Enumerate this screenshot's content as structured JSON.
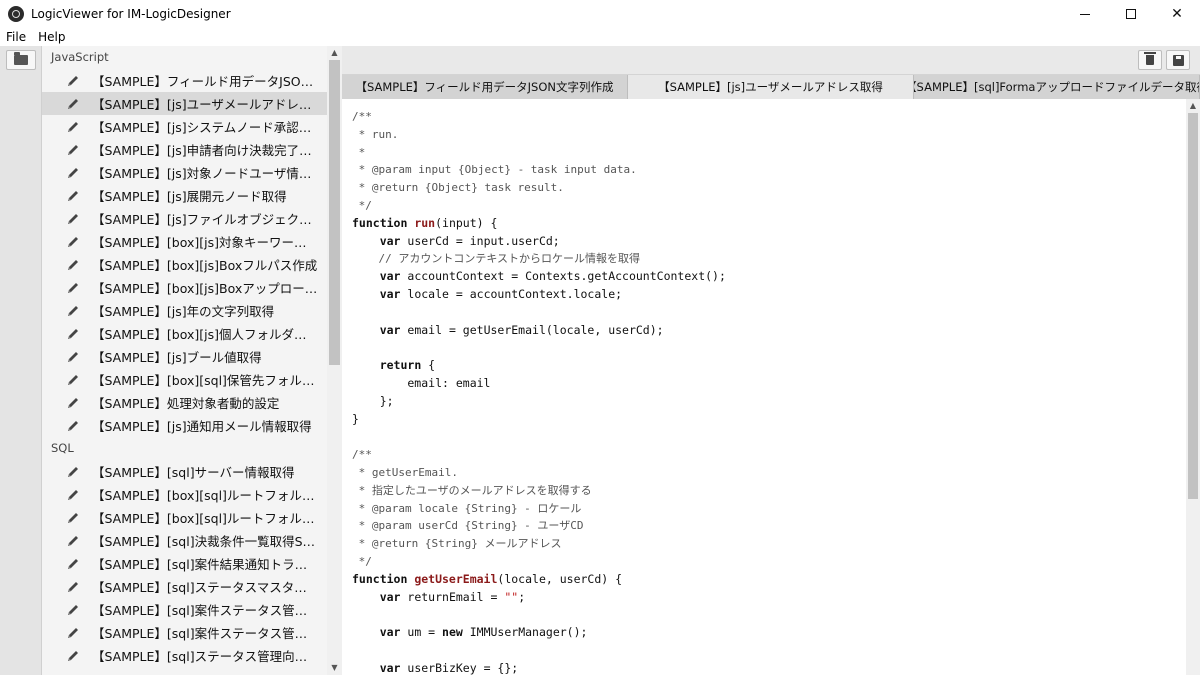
{
  "window": {
    "title": "LogicViewer for IM-LogicDesigner",
    "minimize_icon": "minimize-icon",
    "maximize_icon": "maximize-icon",
    "close_glyph": "✕"
  },
  "menu": {
    "file": "File",
    "help": "Help"
  },
  "toolbar": {
    "open_icon": "folder-icon",
    "delete_icon": "trash-icon",
    "save_icon": "save-icon"
  },
  "sidebar": {
    "groups": [
      {
        "label": "JavaScript",
        "items": [
          "【SAMPLE】フィールド用データJSON文字列作成",
          "【SAMPLE】[js]ユーザメールアドレス取得",
          "【SAMPLE】[js]システムノード承認処理",
          "【SAMPLE】[js]申請者向け決裁完了メール",
          "【SAMPLE】[js]対象ノードユーザ情報取得",
          "【SAMPLE】[js]展開元ノード取得",
          "【SAMPLE】[js]ファイルオブジェクト生成",
          "【SAMPLE】[box][js]対象キーワード検索",
          "【SAMPLE】[box][js]Boxフルパス作成",
          "【SAMPLE】[box][js]Boxアップロード処理",
          "【SAMPLE】[js]年の文字列取得",
          "【SAMPLE】[box][js]個人フォルダ抽出",
          "【SAMPLE】[js]ブール値取得",
          "【SAMPLE】[box][sql]保管先フォルダ取得",
          "【SAMPLE】処理対象者動的設定",
          "【SAMPLE】[js]通知用メール情報取得"
        ]
      },
      {
        "label": "SQL",
        "items": [
          "【SAMPLE】[sql]サーバー情報取得",
          "【SAMPLE】[box][sql]ルートフォルダ取得",
          "【SAMPLE】[box][sql]ルートフォルダ登録",
          "【SAMPLE】[sql]決裁条件一覧取得SQL",
          "【SAMPLE】[sql]案件結果通知トランザクション",
          "【SAMPLE】[sql]ステータスマスタデータ取得",
          "【SAMPLE】[sql]案件ステータス管理登録",
          "【SAMPLE】[sql]案件ステータス管理更新",
          "【SAMPLE】[sql]ステータス管理向け取得"
        ]
      }
    ],
    "selected": {
      "group": 0,
      "item": 1
    }
  },
  "tabs": [
    {
      "label": "【SAMPLE】フィールド用データJSON文字列作成",
      "active": false
    },
    {
      "label": "【SAMPLE】[js]ユーザメールアドレス取得",
      "active": true
    },
    {
      "label": "【SAMPLE】[sql]Formaアップロードファイルデータ取得",
      "active": false
    }
  ],
  "code": [
    {
      "kind": "comment",
      "text": "/**"
    },
    {
      "kind": "comment",
      "text": " * run."
    },
    {
      "kind": "comment",
      "text": " *"
    },
    {
      "kind": "comment",
      "text": " * @param input {Object} - task input data."
    },
    {
      "kind": "comment",
      "text": " * @return {Object} task result."
    },
    {
      "kind": "comment",
      "text": " */"
    },
    {
      "kind": "code",
      "tokens": [
        [
          "kw",
          "function "
        ],
        [
          "fn",
          "run"
        ],
        [
          "",
          "(input) {"
        ]
      ]
    },
    {
      "kind": "code",
      "tokens": [
        [
          "",
          "    "
        ],
        [
          "kw",
          "var "
        ],
        [
          "",
          "userCd = input.userCd;"
        ]
      ]
    },
    {
      "kind": "comment",
      "text": "    // アカウントコンテキストからロケール情報を取得"
    },
    {
      "kind": "code",
      "tokens": [
        [
          "",
          "    "
        ],
        [
          "kw",
          "var "
        ],
        [
          "",
          "accountContext = Contexts.getAccountContext();"
        ]
      ]
    },
    {
      "kind": "code",
      "tokens": [
        [
          "",
          "    "
        ],
        [
          "kw",
          "var "
        ],
        [
          "",
          "locale = accountContext.locale;"
        ]
      ]
    },
    {
      "kind": "code",
      "tokens": [
        [
          "",
          ""
        ]
      ]
    },
    {
      "kind": "code",
      "tokens": [
        [
          "",
          "    "
        ],
        [
          "kw",
          "var "
        ],
        [
          "",
          "email = getUserEmail(locale, userCd);"
        ]
      ]
    },
    {
      "kind": "code",
      "tokens": [
        [
          "",
          ""
        ]
      ]
    },
    {
      "kind": "code",
      "tokens": [
        [
          "",
          "    "
        ],
        [
          "kw",
          "return "
        ],
        [
          "",
          "{"
        ]
      ]
    },
    {
      "kind": "code",
      "tokens": [
        [
          "",
          "        email: email"
        ]
      ]
    },
    {
      "kind": "code",
      "tokens": [
        [
          "",
          "    };"
        ]
      ]
    },
    {
      "kind": "code",
      "tokens": [
        [
          "",
          "}"
        ]
      ]
    },
    {
      "kind": "code",
      "tokens": [
        [
          "",
          ""
        ]
      ]
    },
    {
      "kind": "comment",
      "text": "/**"
    },
    {
      "kind": "comment",
      "text": " * getUserEmail."
    },
    {
      "kind": "comment",
      "text": " * 指定したユーザのメールアドレスを取得する"
    },
    {
      "kind": "comment",
      "text": " * @param locale {String} - ロケール"
    },
    {
      "kind": "comment",
      "text": " * @param userCd {String} - ユーザCD"
    },
    {
      "kind": "comment",
      "text": " * @return {String} メールアドレス"
    },
    {
      "kind": "comment",
      "text": " */"
    },
    {
      "kind": "code",
      "tokens": [
        [
          "kw",
          "function "
        ],
        [
          "fn",
          "getUserEmail"
        ],
        [
          "",
          "(locale, userCd) {"
        ]
      ]
    },
    {
      "kind": "code",
      "tokens": [
        [
          "",
          "    "
        ],
        [
          "kw",
          "var "
        ],
        [
          "",
          "returnEmail = "
        ],
        [
          "str",
          "\"\""
        ],
        [
          "",
          ";"
        ]
      ]
    },
    {
      "kind": "code",
      "tokens": [
        [
          "",
          ""
        ]
      ]
    },
    {
      "kind": "code",
      "tokens": [
        [
          "",
          "    "
        ],
        [
          "kw",
          "var "
        ],
        [
          "",
          "um = "
        ],
        [
          "kw",
          "new "
        ],
        [
          "",
          "IMMUserManager();"
        ]
      ]
    },
    {
      "kind": "code",
      "tokens": [
        [
          "",
          ""
        ]
      ]
    },
    {
      "kind": "code",
      "tokens": [
        [
          "",
          "    "
        ],
        [
          "kw",
          "var "
        ],
        [
          "",
          "userBizKey = {};"
        ]
      ]
    }
  ]
}
